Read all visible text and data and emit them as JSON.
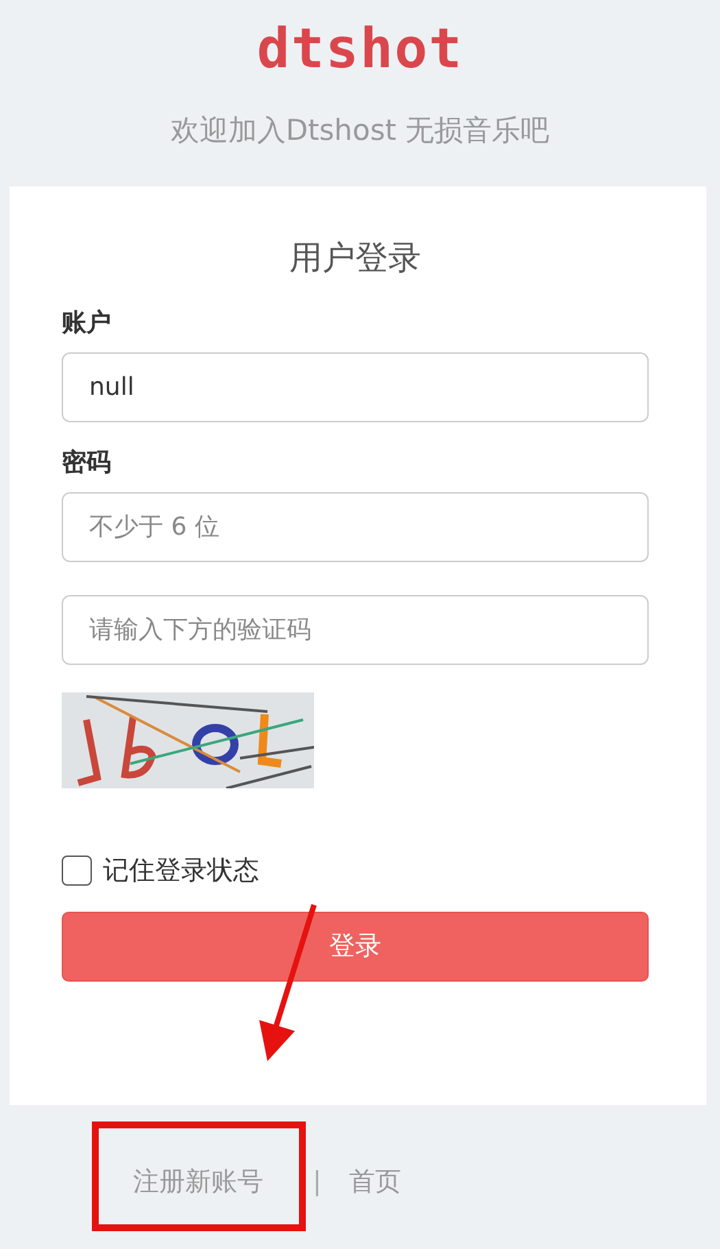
{
  "logo": "dtshot",
  "subtitle": "欢迎加入Dtshost 无损音乐吧",
  "form": {
    "title": "用户登录",
    "fields": [
      {
        "label": "账户",
        "value": "null"
      },
      {
        "label": "密码",
        "placeholder": "不少于 6 位"
      },
      {
        "placeholder": "请输入下方的验证码"
      }
    ],
    "remember": {
      "label": "记住登录状态",
      "checked": false
    },
    "submit": "登录"
  },
  "footer": {
    "links": [
      "注册新账号",
      "首页"
    ],
    "separator": "|"
  }
}
